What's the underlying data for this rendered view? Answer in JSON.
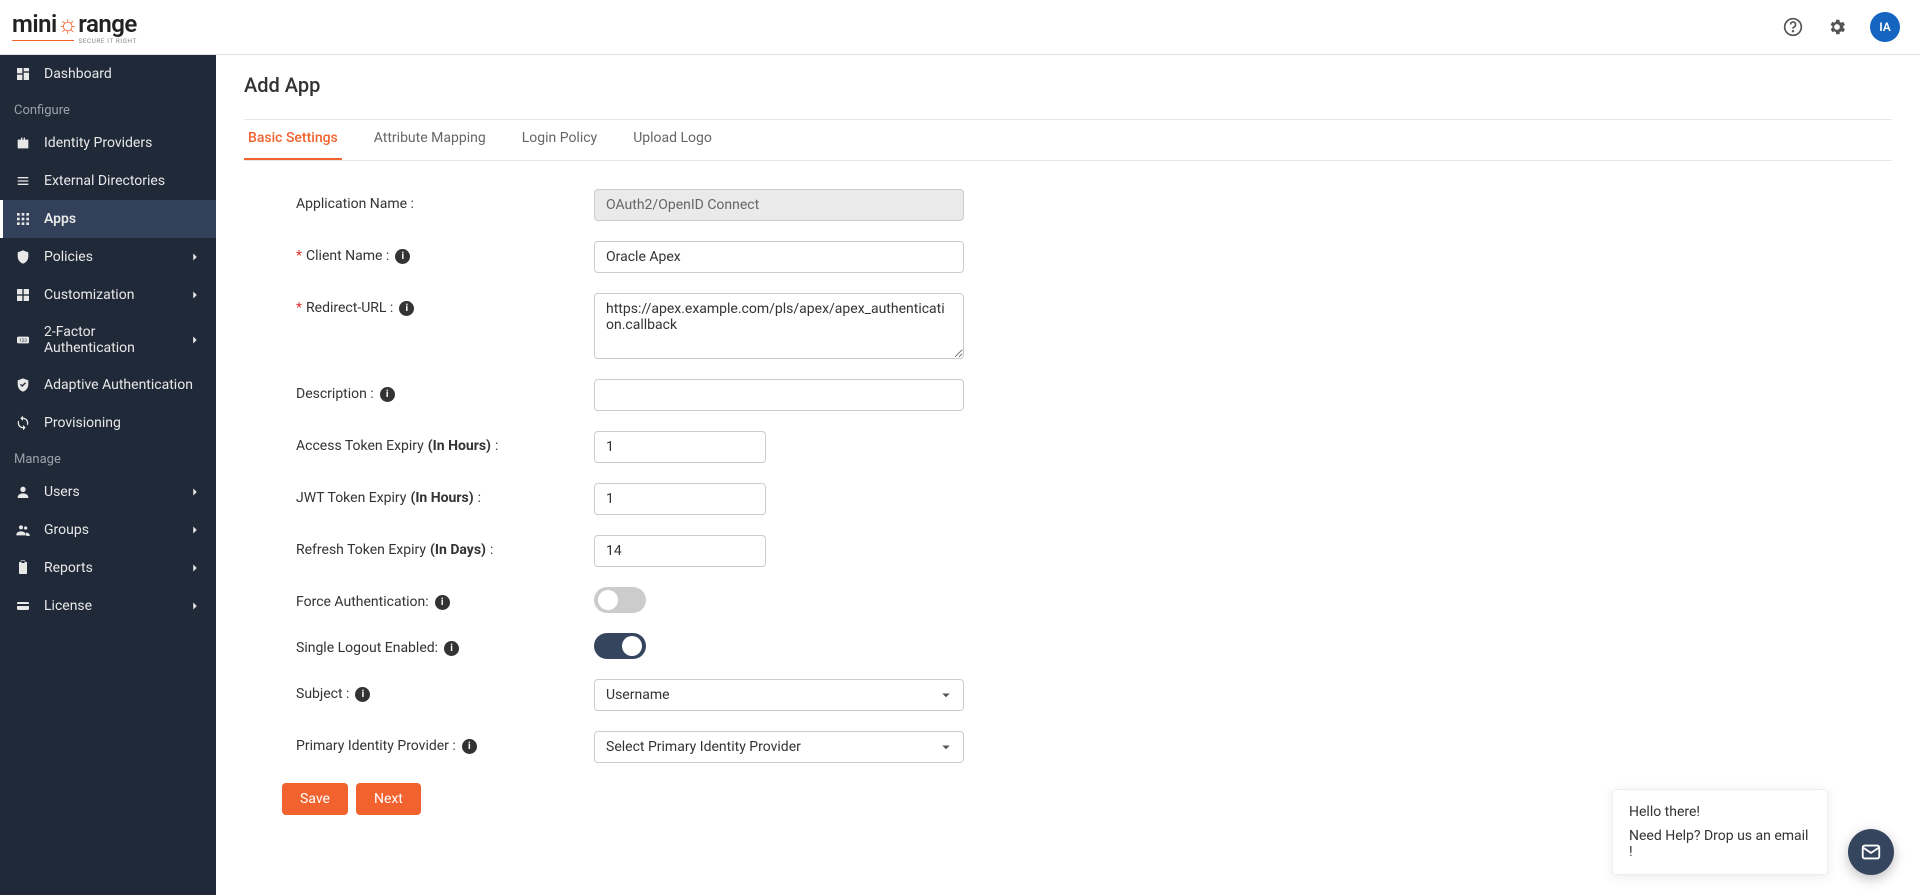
{
  "topbar": {
    "logo_main_a": "mini",
    "logo_main_b": "range",
    "logo_tag": "SECURE IT RIGHT",
    "avatar_initials": "IA"
  },
  "sidebar": {
    "items": [
      {
        "key": "dashboard",
        "label": "Dashboard",
        "icon": "dashboard",
        "chev": false
      },
      {
        "key": "section-configure",
        "label": "Configure",
        "section": true
      },
      {
        "key": "identity-providers",
        "label": "Identity Providers",
        "icon": "bag",
        "chev": false
      },
      {
        "key": "external-directories",
        "label": "External Directories",
        "icon": "list",
        "chev": false
      },
      {
        "key": "apps",
        "label": "Apps",
        "icon": "grid",
        "chev": false,
        "active": true
      },
      {
        "key": "policies",
        "label": "Policies",
        "icon": "shield",
        "chev": true
      },
      {
        "key": "customization",
        "label": "Customization",
        "icon": "plus-square",
        "chev": true
      },
      {
        "key": "2fa",
        "label": "2-Factor Authentication",
        "icon": "123",
        "chev": true
      },
      {
        "key": "adaptive",
        "label": "Adaptive Authentication",
        "icon": "check-shield",
        "chev": false
      },
      {
        "key": "provisioning",
        "label": "Provisioning",
        "icon": "sync",
        "chev": false
      },
      {
        "key": "section-manage",
        "label": "Manage",
        "section": true
      },
      {
        "key": "users",
        "label": "Users",
        "icon": "user",
        "chev": true
      },
      {
        "key": "groups",
        "label": "Groups",
        "icon": "group",
        "chev": true
      },
      {
        "key": "reports",
        "label": "Reports",
        "icon": "clipboard",
        "chev": true
      },
      {
        "key": "license",
        "label": "License",
        "icon": "card",
        "chev": true
      }
    ]
  },
  "page": {
    "title": "Add App"
  },
  "tabs": [
    {
      "key": "basic",
      "label": "Basic Settings",
      "active": true
    },
    {
      "key": "attr",
      "label": "Attribute Mapping"
    },
    {
      "key": "login",
      "label": "Login Policy"
    },
    {
      "key": "logo",
      "label": "Upload Logo"
    }
  ],
  "form": {
    "app_name_label": "Application Name :",
    "app_name_value": "OAuth2/OpenID Connect",
    "client_name_label": "Client Name :",
    "client_name_value": "Oracle Apex",
    "redirect_label": "Redirect-URL :",
    "redirect_value": "https://apex.example.com/pls/apex/apex_authentication.callback",
    "description_label": "Description :",
    "description_value": "",
    "access_token_label_a": "Access Token Expiry ",
    "access_token_label_b": "(In Hours)",
    "access_token_value": "1",
    "jwt_label_a": "JWT Token Expiry ",
    "jwt_label_b": "(In Hours)",
    "jwt_value": "1",
    "refresh_label_a": "Refresh Token Expiry ",
    "refresh_label_b": "(In Days)",
    "refresh_value": "14",
    "force_auth_label": "Force Authentication:",
    "slo_label": "Single Logout Enabled:",
    "subject_label": "Subject :",
    "subject_value": "Username",
    "pip_label": "Primary Identity Provider :",
    "pip_value": "Select Primary Identity Provider",
    "save_label": "Save",
    "next_label": "Next"
  },
  "chat": {
    "hello": "Hello there!",
    "help": "Need Help? Drop us an email !"
  }
}
